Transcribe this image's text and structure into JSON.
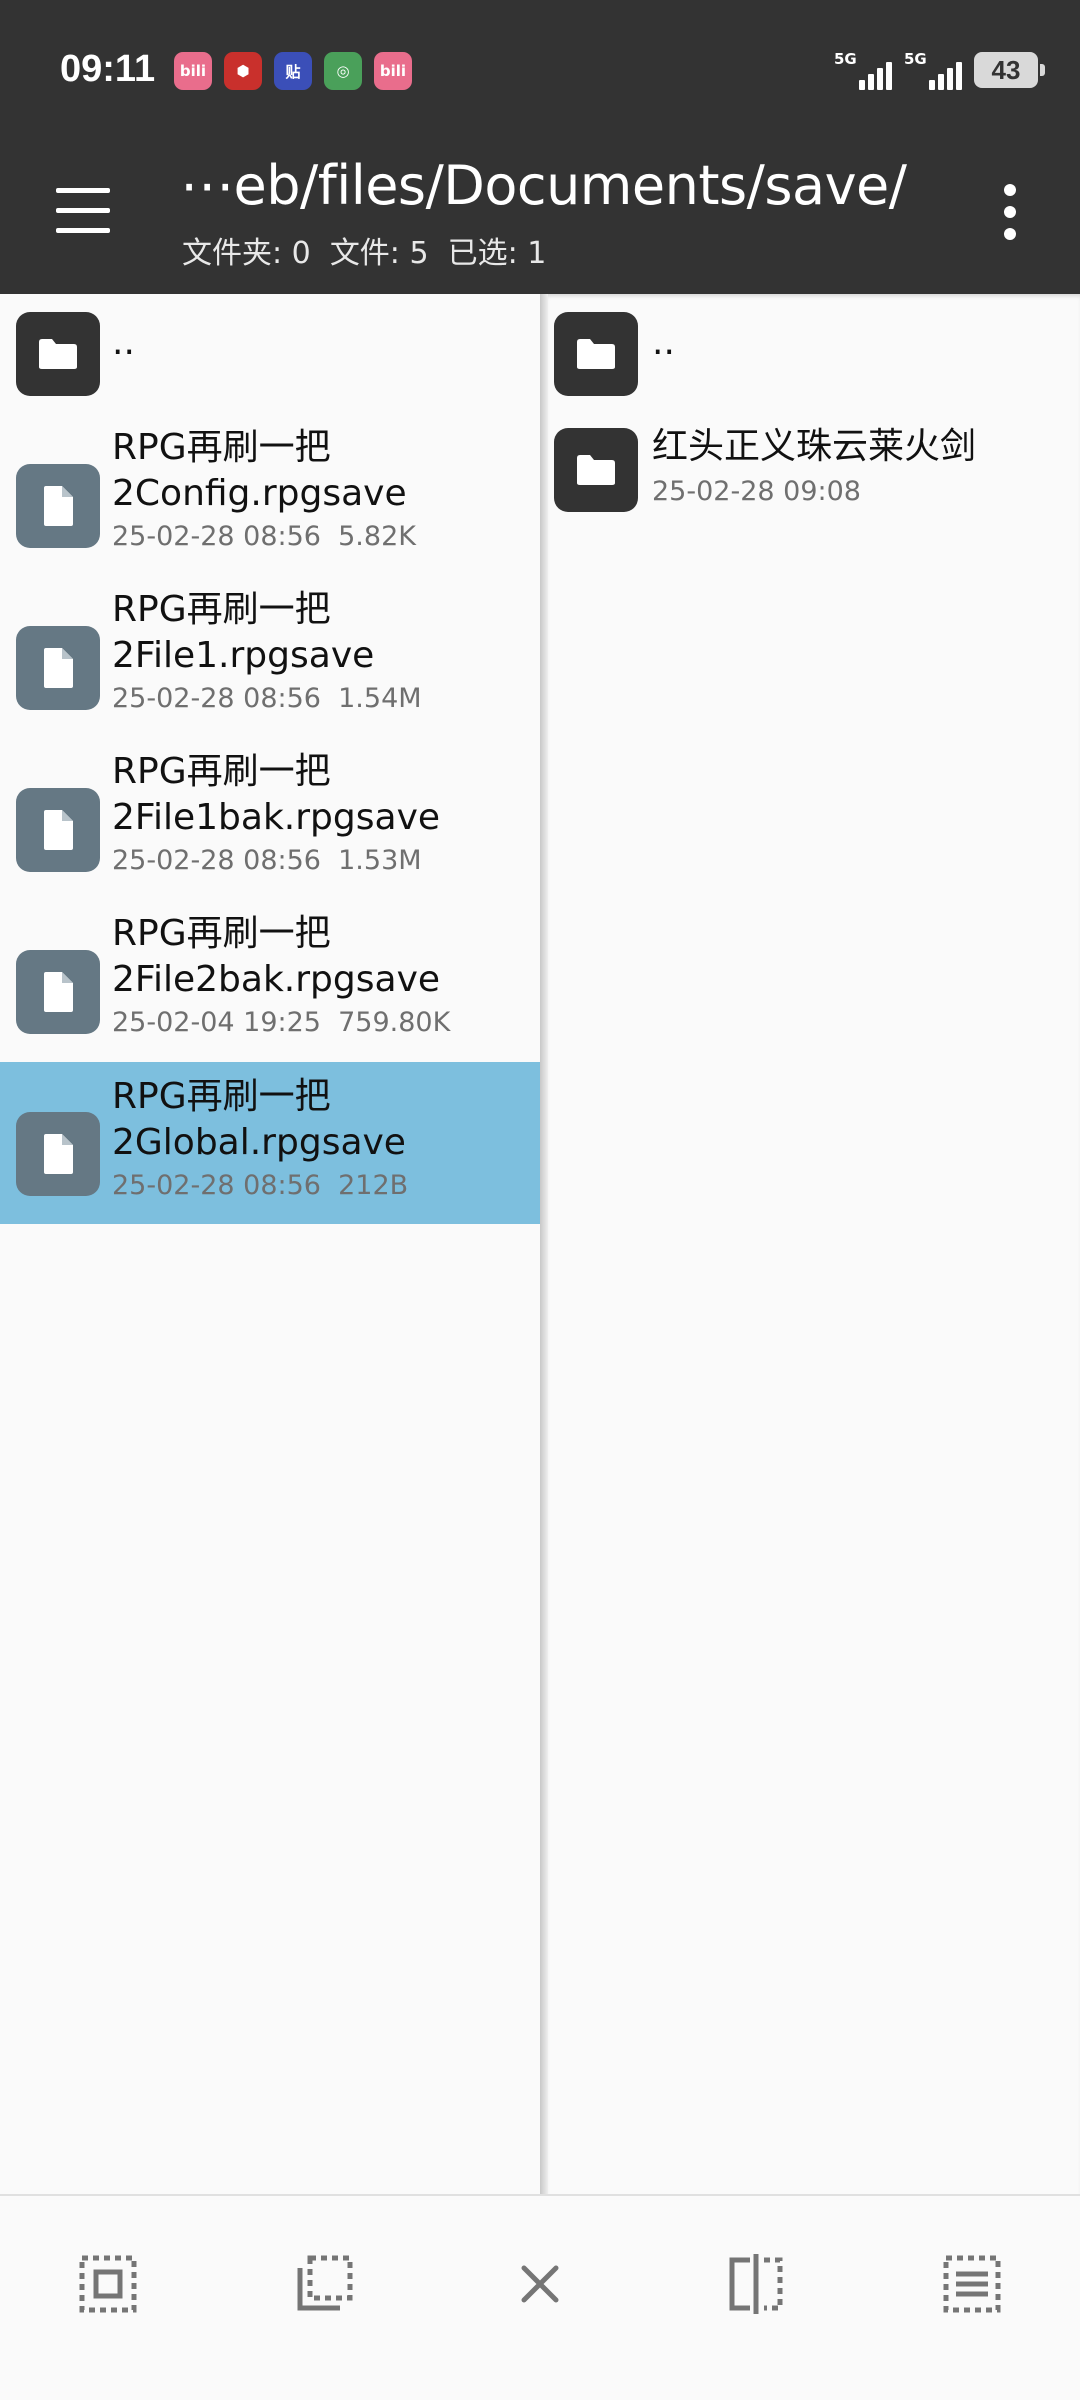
{
  "status_bar": {
    "time": "09:11",
    "notification_icons": [
      {
        "name": "bilibili-icon",
        "label": "bili",
        "color": "#e96d8c"
      },
      {
        "name": "app-store-icon",
        "label": "⬢",
        "color": "#c9302c"
      },
      {
        "name": "tieba-icon",
        "label": "贴",
        "color": "#3b4fb8"
      },
      {
        "name": "china-mobile-icon",
        "label": "◎",
        "color": "#4aa05a"
      },
      {
        "name": "bilibili-icon-2",
        "label": "bili",
        "color": "#e96d8c"
      }
    ],
    "signal_1": "5G",
    "signal_2": "5G",
    "battery": "43"
  },
  "toolbar": {
    "path": "⋯eb/files/Documents/save/",
    "folders_label": "文件夹: 0",
    "files_label": "文件: 5",
    "selected_label": "已选: 1"
  },
  "left_pane": {
    "parent": {
      "name": ".."
    },
    "files": [
      {
        "name_line1": "RPG再刷一把",
        "name_line2": "2Config.rpgsave",
        "date": "25-02-28 08:56",
        "size": "5.82K"
      },
      {
        "name_line1": "RPG再刷一把",
        "name_line2": "2File1.rpgsave",
        "date": "25-02-28 08:56",
        "size": "1.54M"
      },
      {
        "name_line1": "RPG再刷一把",
        "name_line2": "2File1bak.rpgsave",
        "date": "25-02-28 08:56",
        "size": "1.53M"
      },
      {
        "name_line1": "RPG再刷一把",
        "name_line2": "2File2bak.rpgsave",
        "date": "25-02-04 19:25",
        "size": "759.80K"
      },
      {
        "name_line1": "RPG再刷一把",
        "name_line2": "2Global.rpgsave",
        "date": "25-02-28 08:56",
        "size": "212B"
      }
    ]
  },
  "right_pane": {
    "parent": {
      "name": ".."
    },
    "folders": [
      {
        "name": "红头正义珠云莱火剑",
        "date": "25-02-28 09:08"
      }
    ]
  },
  "colors": {
    "bar_bg": "#333333",
    "selected_row": "#7dbfde",
    "file_tile": "#657884",
    "icon_gray": "#757575"
  }
}
